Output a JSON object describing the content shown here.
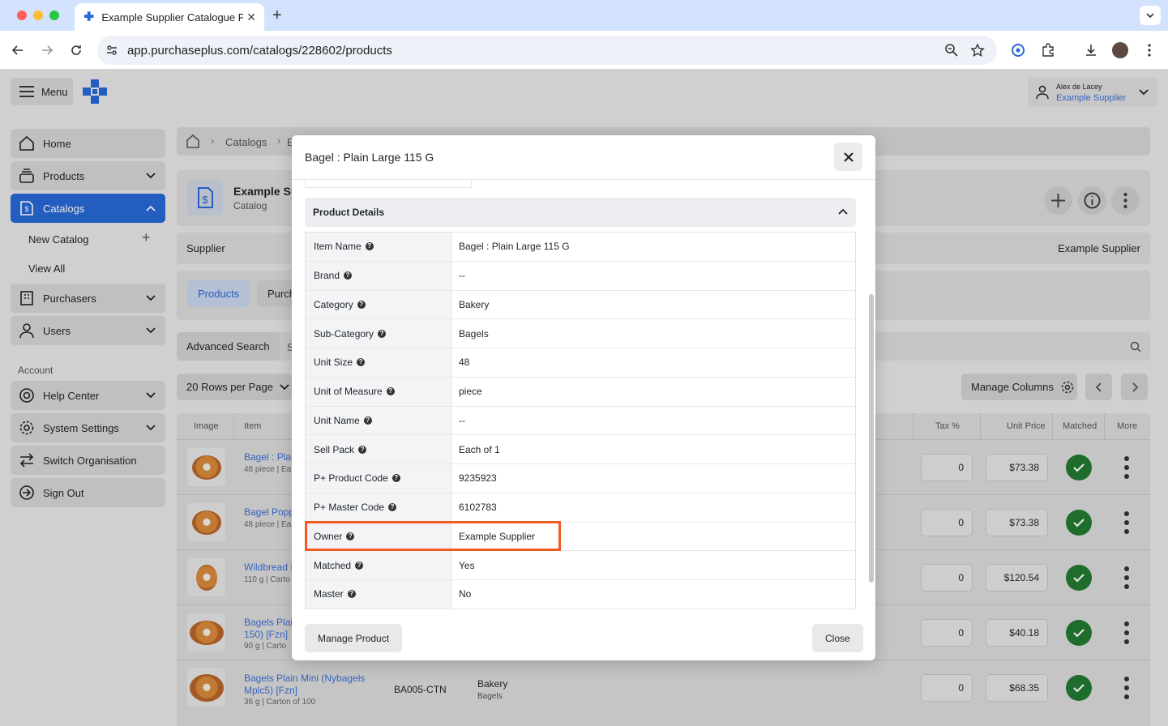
{
  "browser": {
    "tab_title": "Example Supplier Catalogue P",
    "url": "app.purchaseplus.com/catalogs/228602/products"
  },
  "header": {
    "menu_label": "Menu",
    "user_name": "Alex de Lacey",
    "user_org": "Example Supplier"
  },
  "sidebar": {
    "items": [
      {
        "label": "Home"
      },
      {
        "label": "Products"
      },
      {
        "label": "Catalogs"
      },
      {
        "label": "Purchasers"
      },
      {
        "label": "Users"
      },
      {
        "label": "Help Center"
      },
      {
        "label": "System Settings"
      },
      {
        "label": "Switch Organisation"
      },
      {
        "label": "Sign Out"
      }
    ],
    "sub_items": [
      "New Catalog",
      "View All"
    ],
    "section_account": "Account"
  },
  "main": {
    "breadcrumb": "Catalogs",
    "breadcrumb_trail": "E",
    "catalog_title": "Example Su",
    "catalog_subtitle": "Catalog",
    "supplier_label": "Supplier",
    "supplier_value": "Example Supplier",
    "tab_products": "Products",
    "tab_purchasers": "Purch",
    "advanced_search": "Advanced Search",
    "search_stub": "S",
    "rows_per_page": "20 Rows per Page",
    "manage_columns": "Manage Columns",
    "columns": [
      "Image",
      "Item",
      "Tax %",
      "Unit Price",
      "Matched",
      "More"
    ],
    "rows": [
      {
        "name": "Bagel : Plai",
        "meta": "48 piece | Ea",
        "code": "",
        "category": "",
        "subcategory": "",
        "tax": "0",
        "price": "$73.38"
      },
      {
        "name": "Bagel Popp",
        "meta": "48 piece | Ea",
        "code": "",
        "category": "",
        "subcategory": "",
        "tax": "0",
        "price": "$73.38"
      },
      {
        "name": "Wildbread I",
        "meta": "110 g | Carto",
        "code": "",
        "category": "",
        "subcategory": "",
        "tax": "0",
        "price": "$120.54"
      },
      {
        "name": "Bagels Plai\n150) [Fzn]",
        "meta": "90 g | Carto",
        "code": "",
        "category": "",
        "subcategory": "",
        "tax": "0",
        "price": "$40.18"
      },
      {
        "name": "Bagels Plain Mini (Nybagels Mplc5) [Fzn]",
        "meta": "36 g | Carton of 100",
        "code": "BA005-CTN",
        "category": "Bakery",
        "subcategory": "Bagels",
        "tax": "0",
        "price": "$68.35"
      }
    ]
  },
  "modal": {
    "title": "Bagel : Plain Large 115 G",
    "section_title": "Product Details",
    "details": [
      {
        "label": "Item Name",
        "value": "Bagel : Plain Large 115 G"
      },
      {
        "label": "Brand",
        "value": "--"
      },
      {
        "label": "Category",
        "value": "Bakery"
      },
      {
        "label": "Sub-Category",
        "value": "Bagels"
      },
      {
        "label": "Unit Size",
        "value": "48"
      },
      {
        "label": "Unit of Measure",
        "value": "piece"
      },
      {
        "label": "Unit Name",
        "value": "--"
      },
      {
        "label": "Sell Pack",
        "value": "Each of 1"
      },
      {
        "label": "P+ Product Code",
        "value": "9235923"
      },
      {
        "label": "P+ Master Code",
        "value": "6102783"
      },
      {
        "label": "Owner",
        "value": "Example Supplier"
      },
      {
        "label": "Matched",
        "value": "Yes"
      },
      {
        "label": "Master",
        "value": "No"
      }
    ],
    "manage_button": "Manage Product",
    "close_button": "Close"
  },
  "colors": {
    "accent": "#2868d6",
    "link": "#3b6fd6",
    "highlight": "#f05a23",
    "matched": "#237a32"
  }
}
